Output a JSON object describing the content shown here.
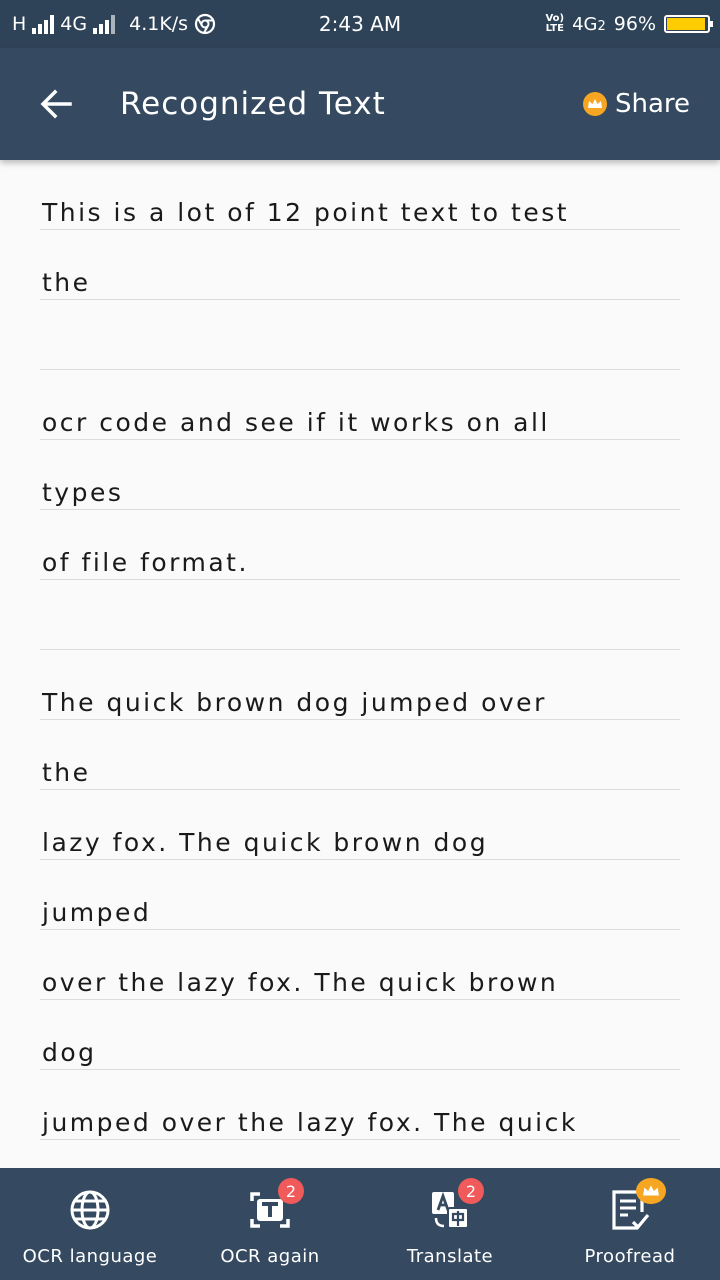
{
  "status_bar": {
    "network_left": "H",
    "network_4g": "4G",
    "speed": "4.1K/s",
    "time": "2:43 AM",
    "volte_top": "Vo)",
    "volte_bottom": "LTE",
    "network_right": "4G",
    "sim": "2",
    "battery_percent": "96%",
    "battery_level": 0.96,
    "battery_color": "#ffcc00"
  },
  "app_bar": {
    "title": "Recognized Text",
    "share_label": "Share",
    "background": "#354a60"
  },
  "lines": [
    "This is a lot of 12 point text to test",
    "the",
    "",
    "ocr code and see if it works on all",
    "types",
    "of file format.",
    "",
    "The quick brown dog jumped over",
    "the",
    "lazy fox. The quick brown dog",
    "jumped",
    "over the lazy fox. The quick brown",
    "dog",
    "jumped over the lazy fox. The quick"
  ],
  "bottom_nav": {
    "items": [
      {
        "label": "OCR language",
        "icon": "globe-icon"
      },
      {
        "label": "OCR again",
        "icon": "ocr-scan-icon",
        "badge": "2"
      },
      {
        "label": "Translate",
        "icon": "translate-icon",
        "badge": "2"
      },
      {
        "label": "Proofread",
        "icon": "proofread-icon",
        "premium": true
      }
    ],
    "badge_color": "#f05a5a",
    "premium_color": "#f6a623"
  }
}
